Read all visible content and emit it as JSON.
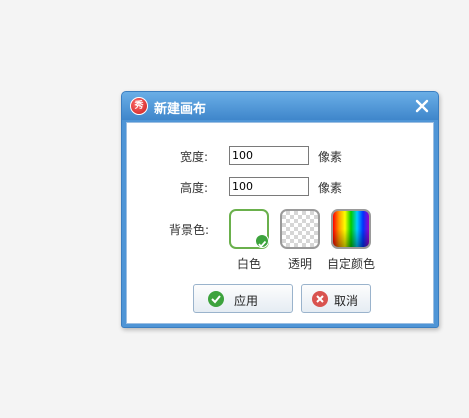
{
  "dialog": {
    "title": "新建画布",
    "app_icon_text": "秀",
    "width_label": "宽度:",
    "width_value": "100",
    "width_unit": "像素",
    "height_label": "高度:",
    "height_value": "100",
    "height_unit": "像素",
    "bg_label": "背景色:",
    "swatches": [
      {
        "label": "白色",
        "selected": true
      },
      {
        "label": "透明",
        "selected": false
      },
      {
        "label": "自定颜色",
        "selected": false
      }
    ],
    "apply_label": "应用",
    "cancel_label": "取消"
  },
  "colors": {
    "titlebar": "#4f95d6",
    "selected_border": "#6ab04c",
    "apply_icon": "#3da33d",
    "cancel_icon": "#d9534f"
  },
  "icons": [
    "app-logo-icon",
    "close-icon",
    "check-icon",
    "cancel-icon"
  ]
}
